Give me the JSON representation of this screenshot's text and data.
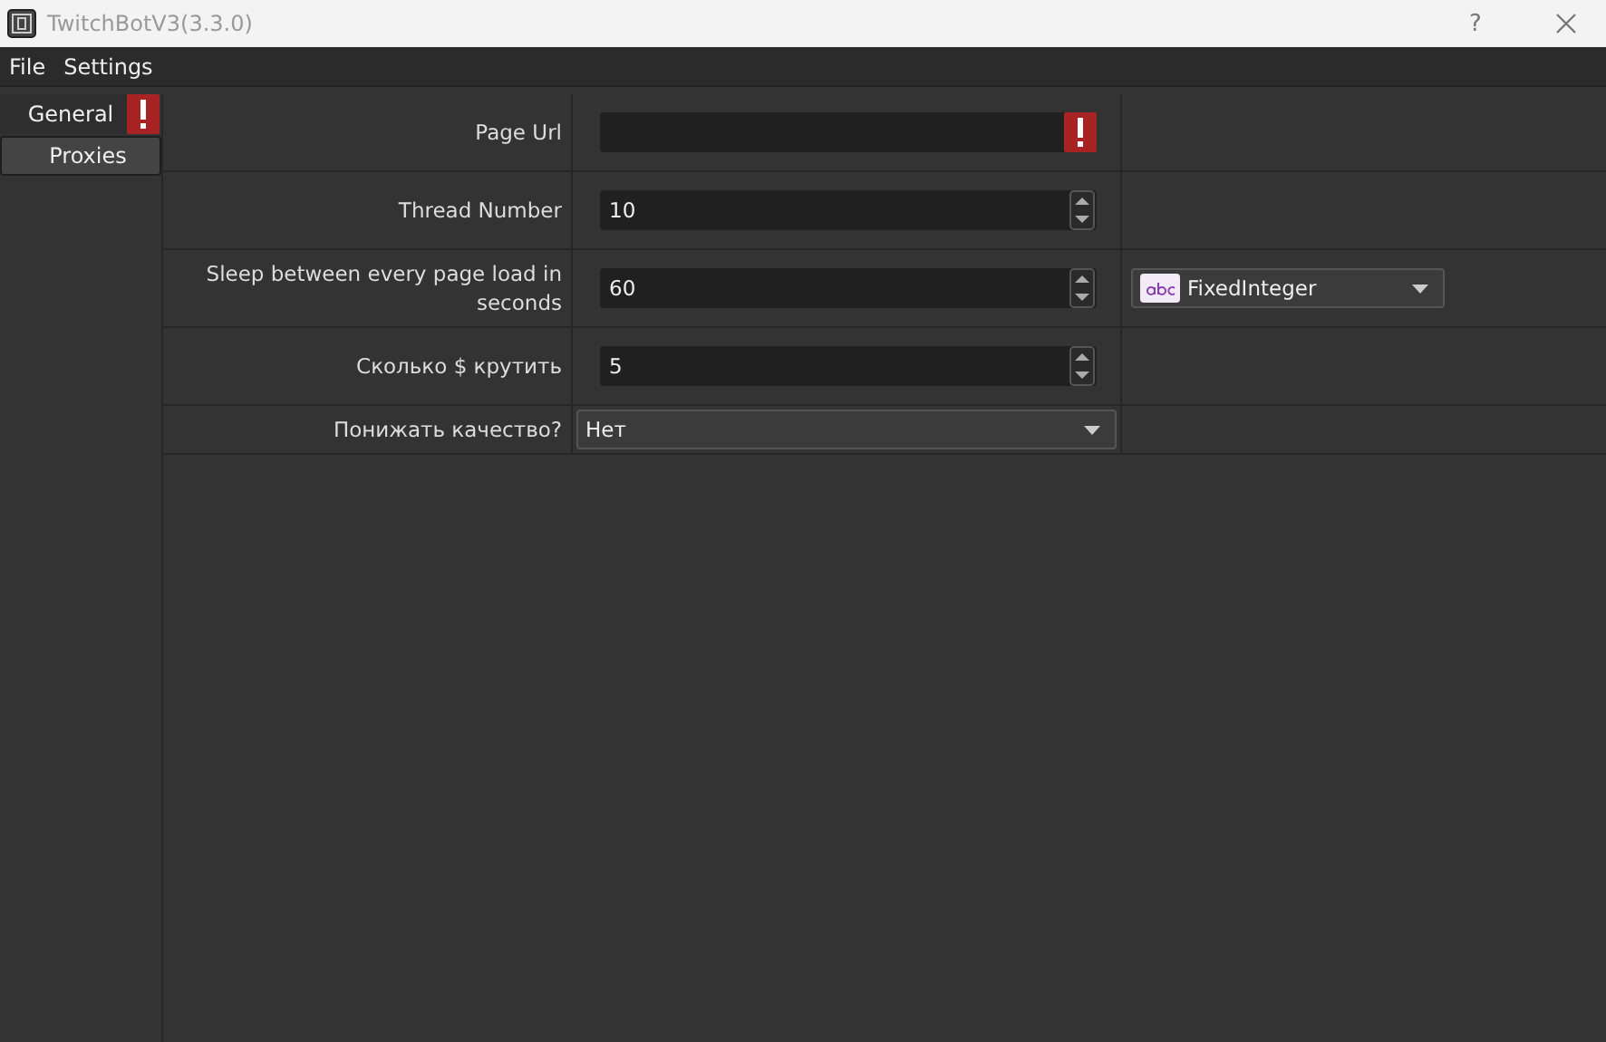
{
  "window": {
    "title": "TwitchBotV3(3.3.0)",
    "help": "?"
  },
  "menu": [
    "File",
    "Settings"
  ],
  "tabs": [
    {
      "label": "General",
      "selected": true,
      "error": true
    },
    {
      "label": "Proxies",
      "selected": false,
      "error": false
    }
  ],
  "rows": [
    {
      "label": "Page Url",
      "kind": "text",
      "value": "",
      "error": true
    },
    {
      "label": "Thread Number",
      "kind": "spin",
      "value": "10",
      "error": false
    },
    {
      "label": "Sleep between every page load in seconds",
      "kind": "spin",
      "value": "60",
      "error": false,
      "extra": {
        "kind": "type-combo",
        "value": "FixedInteger"
      }
    },
    {
      "label": "Сколько $ крутить",
      "kind": "spin",
      "value": "5",
      "error": false
    },
    {
      "label": "Понижать качество?",
      "kind": "combo",
      "value": "Нет",
      "error": false
    }
  ]
}
